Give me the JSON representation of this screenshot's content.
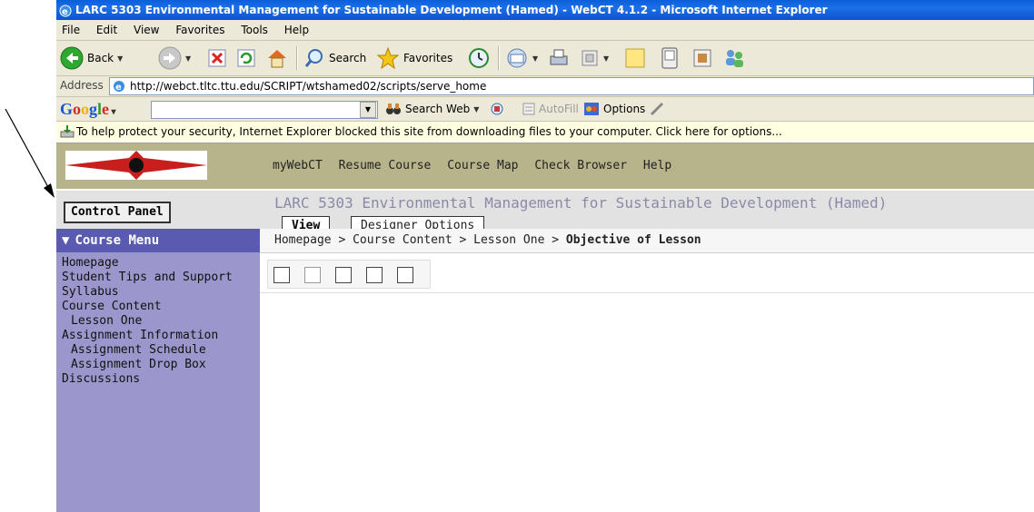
{
  "window": {
    "title": "LARC 5303 Environmental Management for Sustainable Development (Hamed) - WebCT 4.1.2 - Microsoft Internet Explorer"
  },
  "menubar": [
    "File",
    "Edit",
    "View",
    "Favorites",
    "Tools",
    "Help"
  ],
  "toolbar": {
    "back_label": "Back",
    "search_label": "Search",
    "favorites_label": "Favorites"
  },
  "address": {
    "label": "Address",
    "url": "http://webct.tltc.ttu.edu/SCRIPT/wtshamed02/scripts/serve_home"
  },
  "google": {
    "search_web_label": "Search Web",
    "autofill_label": "AutoFill",
    "options_label": "Options"
  },
  "infobar": {
    "text": "To help protect your security, Internet Explorer blocked this site from downloading files to your computer. Click here for options..."
  },
  "webct": {
    "nav": [
      "myWebCT",
      "Resume Course",
      "Course Map",
      "Check Browser",
      "Help"
    ],
    "control_panel_label": "Control Panel",
    "course_title": "LARC 5303 Environmental Management for Sustainable Development (Hamed)",
    "tabs": [
      "View",
      "Designer Options"
    ],
    "course_menu_label": "Course Menu",
    "breadcrumb": {
      "trail": "Homepage > Course Content > Lesson One > ",
      "current": "Objective of Lesson"
    },
    "menu_items": [
      {
        "label": "Homepage",
        "indent": 0
      },
      {
        "label": "Student Tips and Support",
        "indent": 0
      },
      {
        "label": "Syllabus",
        "indent": 0
      },
      {
        "label": "Course Content",
        "indent": 0
      },
      {
        "label": "Lesson One",
        "indent": 1
      },
      {
        "label": "Assignment Information",
        "indent": 0
      },
      {
        "label": "Assignment Schedule",
        "indent": 1
      },
      {
        "label": "Assignment Drop Box",
        "indent": 1
      },
      {
        "label": "Discussions",
        "indent": 0
      }
    ]
  },
  "colors": {
    "titlebar": "#0b52cf",
    "webct_nav": "#b7b38a",
    "course_menu_head": "#5a5ab0",
    "course_menu_bg": "#9b97cc",
    "infobar": "#ffffe1"
  }
}
